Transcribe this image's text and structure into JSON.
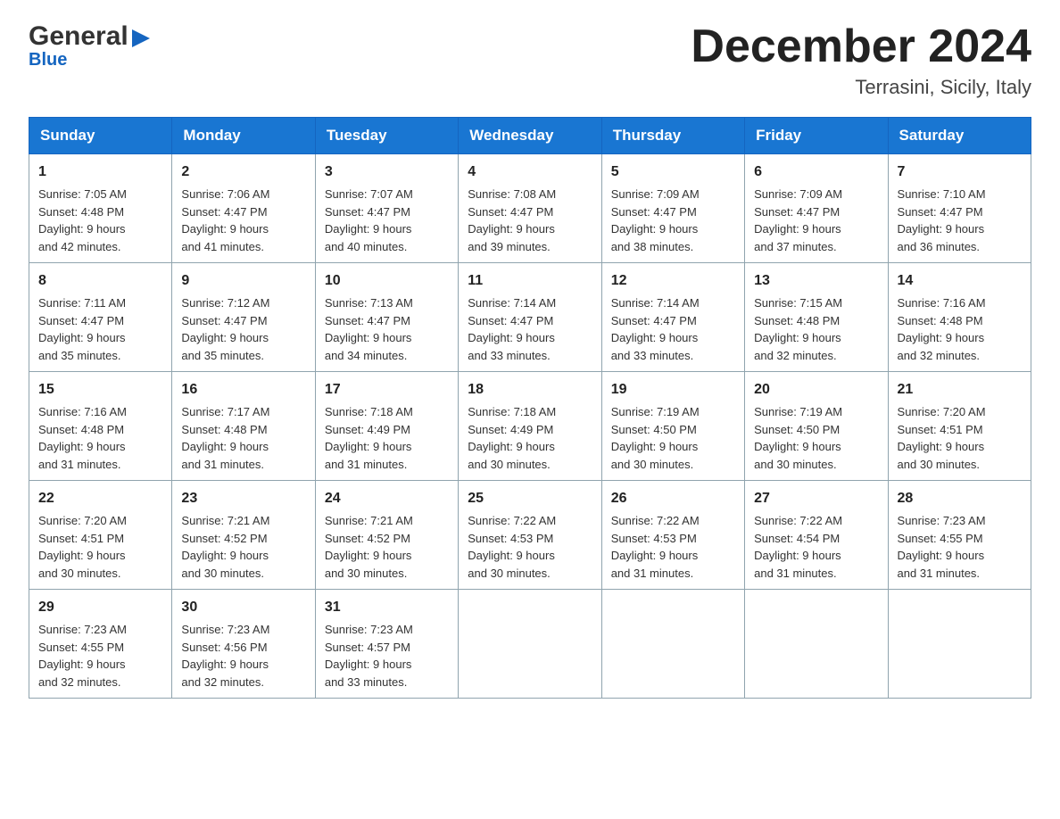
{
  "header": {
    "logo_general": "General",
    "logo_blue": "Blue",
    "month_title": "December 2024",
    "location": "Terrasini, Sicily, Italy"
  },
  "days_of_week": [
    "Sunday",
    "Monday",
    "Tuesday",
    "Wednesday",
    "Thursday",
    "Friday",
    "Saturday"
  ],
  "weeks": [
    [
      {
        "day": "1",
        "sunrise": "7:05 AM",
        "sunset": "4:48 PM",
        "daylight": "9 hours and 42 minutes."
      },
      {
        "day": "2",
        "sunrise": "7:06 AM",
        "sunset": "4:47 PM",
        "daylight": "9 hours and 41 minutes."
      },
      {
        "day": "3",
        "sunrise": "7:07 AM",
        "sunset": "4:47 PM",
        "daylight": "9 hours and 40 minutes."
      },
      {
        "day": "4",
        "sunrise": "7:08 AM",
        "sunset": "4:47 PM",
        "daylight": "9 hours and 39 minutes."
      },
      {
        "day": "5",
        "sunrise": "7:09 AM",
        "sunset": "4:47 PM",
        "daylight": "9 hours and 38 minutes."
      },
      {
        "day": "6",
        "sunrise": "7:09 AM",
        "sunset": "4:47 PM",
        "daylight": "9 hours and 37 minutes."
      },
      {
        "day": "7",
        "sunrise": "7:10 AM",
        "sunset": "4:47 PM",
        "daylight": "9 hours and 36 minutes."
      }
    ],
    [
      {
        "day": "8",
        "sunrise": "7:11 AM",
        "sunset": "4:47 PM",
        "daylight": "9 hours and 35 minutes."
      },
      {
        "day": "9",
        "sunrise": "7:12 AM",
        "sunset": "4:47 PM",
        "daylight": "9 hours and 35 minutes."
      },
      {
        "day": "10",
        "sunrise": "7:13 AM",
        "sunset": "4:47 PM",
        "daylight": "9 hours and 34 minutes."
      },
      {
        "day": "11",
        "sunrise": "7:14 AM",
        "sunset": "4:47 PM",
        "daylight": "9 hours and 33 minutes."
      },
      {
        "day": "12",
        "sunrise": "7:14 AM",
        "sunset": "4:47 PM",
        "daylight": "9 hours and 33 minutes."
      },
      {
        "day": "13",
        "sunrise": "7:15 AM",
        "sunset": "4:48 PM",
        "daylight": "9 hours and 32 minutes."
      },
      {
        "day": "14",
        "sunrise": "7:16 AM",
        "sunset": "4:48 PM",
        "daylight": "9 hours and 32 minutes."
      }
    ],
    [
      {
        "day": "15",
        "sunrise": "7:16 AM",
        "sunset": "4:48 PM",
        "daylight": "9 hours and 31 minutes."
      },
      {
        "day": "16",
        "sunrise": "7:17 AM",
        "sunset": "4:48 PM",
        "daylight": "9 hours and 31 minutes."
      },
      {
        "day": "17",
        "sunrise": "7:18 AM",
        "sunset": "4:49 PM",
        "daylight": "9 hours and 31 minutes."
      },
      {
        "day": "18",
        "sunrise": "7:18 AM",
        "sunset": "4:49 PM",
        "daylight": "9 hours and 30 minutes."
      },
      {
        "day": "19",
        "sunrise": "7:19 AM",
        "sunset": "4:50 PM",
        "daylight": "9 hours and 30 minutes."
      },
      {
        "day": "20",
        "sunrise": "7:19 AM",
        "sunset": "4:50 PM",
        "daylight": "9 hours and 30 minutes."
      },
      {
        "day": "21",
        "sunrise": "7:20 AM",
        "sunset": "4:51 PM",
        "daylight": "9 hours and 30 minutes."
      }
    ],
    [
      {
        "day": "22",
        "sunrise": "7:20 AM",
        "sunset": "4:51 PM",
        "daylight": "9 hours and 30 minutes."
      },
      {
        "day": "23",
        "sunrise": "7:21 AM",
        "sunset": "4:52 PM",
        "daylight": "9 hours and 30 minutes."
      },
      {
        "day": "24",
        "sunrise": "7:21 AM",
        "sunset": "4:52 PM",
        "daylight": "9 hours and 30 minutes."
      },
      {
        "day": "25",
        "sunrise": "7:22 AM",
        "sunset": "4:53 PM",
        "daylight": "9 hours and 30 minutes."
      },
      {
        "day": "26",
        "sunrise": "7:22 AM",
        "sunset": "4:53 PM",
        "daylight": "9 hours and 31 minutes."
      },
      {
        "day": "27",
        "sunrise": "7:22 AM",
        "sunset": "4:54 PM",
        "daylight": "9 hours and 31 minutes."
      },
      {
        "day": "28",
        "sunrise": "7:23 AM",
        "sunset": "4:55 PM",
        "daylight": "9 hours and 31 minutes."
      }
    ],
    [
      {
        "day": "29",
        "sunrise": "7:23 AM",
        "sunset": "4:55 PM",
        "daylight": "9 hours and 32 minutes."
      },
      {
        "day": "30",
        "sunrise": "7:23 AM",
        "sunset": "4:56 PM",
        "daylight": "9 hours and 32 minutes."
      },
      {
        "day": "31",
        "sunrise": "7:23 AM",
        "sunset": "4:57 PM",
        "daylight": "9 hours and 33 minutes."
      },
      null,
      null,
      null,
      null
    ]
  ],
  "labels": {
    "sunrise": "Sunrise:",
    "sunset": "Sunset:",
    "daylight": "Daylight:"
  }
}
